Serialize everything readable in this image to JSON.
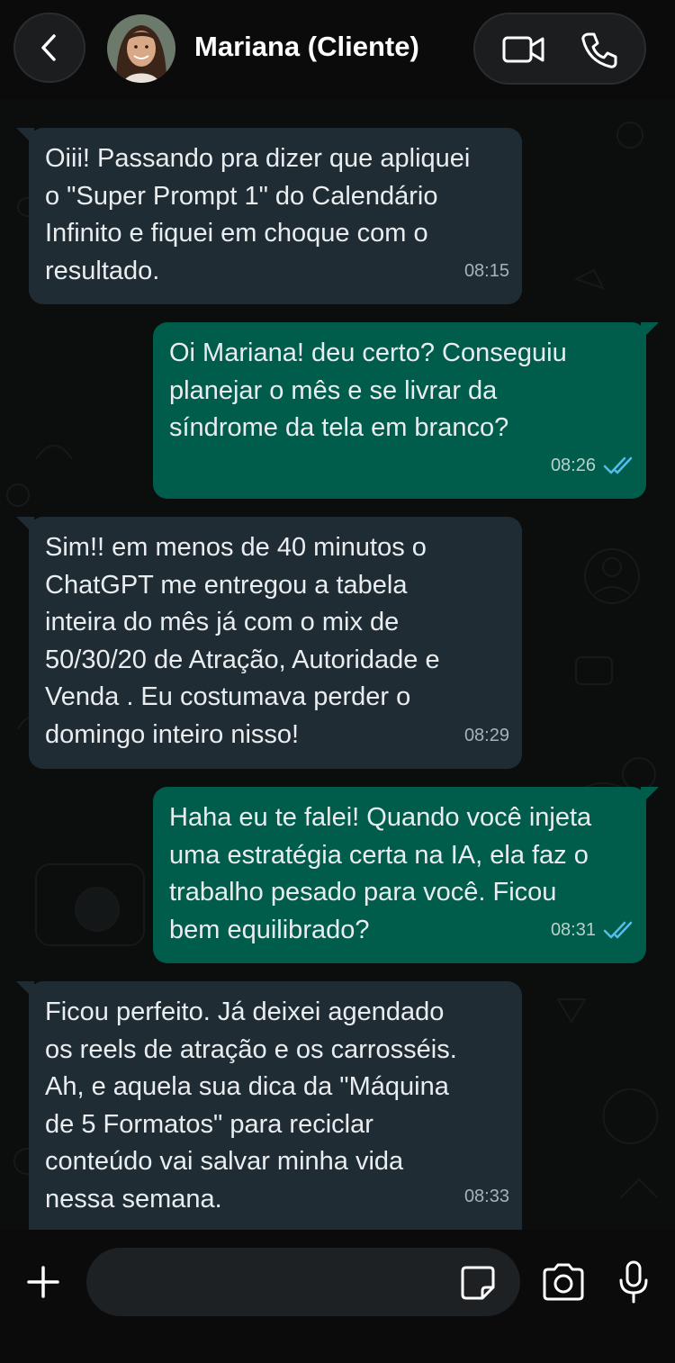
{
  "header": {
    "contact_name": "Mariana (Cliente)",
    "back_icon": "chevron-left-icon",
    "video_icon": "video-camera-icon",
    "phone_icon": "phone-icon"
  },
  "messages": [
    {
      "direction": "in",
      "text": "Oiii! Passando pra dizer que apliquei\no \"Super Prompt 1\" do Calendário\nInfinito e fiquei em choque com o\nresultado.",
      "time": "08:15"
    },
    {
      "direction": "out",
      "text": "Oi Mariana! deu certo? Conseguiu\nplanejar o mês e se livrar da\nsíndrome da tela em branco?",
      "time": "08:26",
      "status": "read"
    },
    {
      "direction": "in",
      "text": "Sim!! em menos de 40 minutos o\nChatGPT me entregou a tabela\ninteira do mês já com o mix de\n50/30/20 de Atração, Autoridade e\nVenda . Eu costumava perder o\ndomingo inteiro nisso!",
      "time": "08:29"
    },
    {
      "direction": "out",
      "text": "Haha eu te falei! Quando você injeta\numa estratégia certa na IA, ela faz o\ntrabalho pesado para você. Ficou\nbem equilibrado?",
      "time": "08:31",
      "status": "read"
    },
    {
      "direction": "in",
      "text": "Ficou perfeito. Já deixei agendado\nos reels de atração e os carrosséis.\nAh, e aquela sua dica da \"Máquina\nde 5 Formatos\" para reciclar\nconteúdo vai salvar minha vida\nnessa semana.",
      "time": "08:33"
    }
  ],
  "composer": {
    "placeholder": "",
    "plus_icon": "plus-icon",
    "sticker_icon": "sticker-icon",
    "camera_icon": "camera-icon",
    "mic_icon": "microphone-icon"
  },
  "colors": {
    "incoming_bubble": "#202c33",
    "outgoing_bubble": "#005c4b",
    "read_ticks": "#53bdeb",
    "background": "#0b0b0b"
  }
}
